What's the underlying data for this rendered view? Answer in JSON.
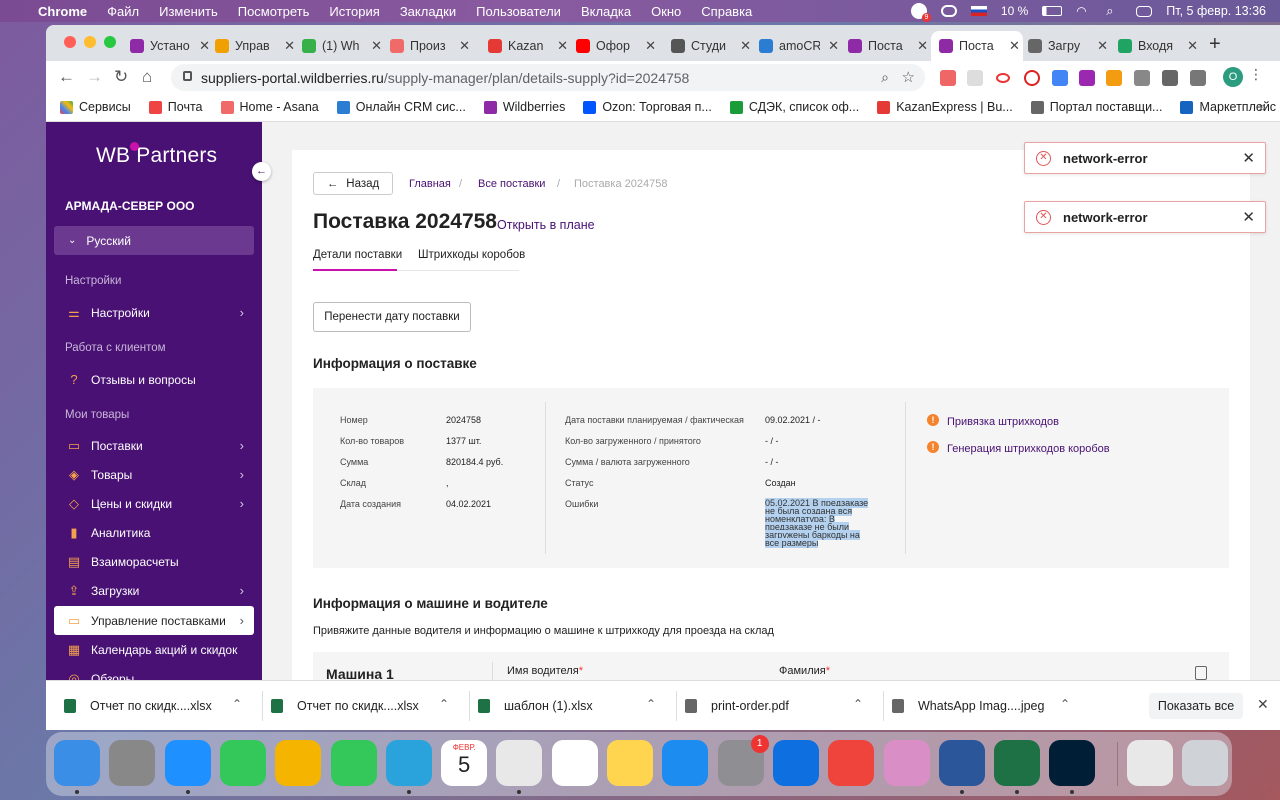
{
  "menubar": {
    "app": "Chrome",
    "menus": [
      "Файл",
      "Изменить",
      "Посмотреть",
      "История",
      "Закладки",
      "Пользователи",
      "Вкладка",
      "Окно",
      "Справка"
    ],
    "battery": "10 %",
    "datetime": "Пт, 5 февр.  13:36",
    "notification_count": "9"
  },
  "tabs": [
    {
      "title": "Устано",
      "icon": "wildberries-icon",
      "color": "#8e2aa5"
    },
    {
      "title": "Управ",
      "icon": "aliexpress-icon",
      "color": "#f0a000"
    },
    {
      "title": "(1) Wh",
      "icon": "whatsapp-icon",
      "color": "#36b14a"
    },
    {
      "title": "Произ",
      "icon": "asana-icon",
      "color": "#f06a6a"
    },
    {
      "title": "Kazan",
      "icon": "kazanexpress-icon",
      "color": "#e53935"
    },
    {
      "title": "Офор",
      "icon": "youtube-icon",
      "color": "#ff0000"
    },
    {
      "title": "Студи",
      "icon": "kazanexpress-icon",
      "color": "#555"
    },
    {
      "title": "amoCR",
      "icon": "amocrm-icon",
      "color": "#2b7cd3"
    },
    {
      "title": "Поста",
      "icon": "wildberries-icon",
      "color": "#8e2aa5"
    },
    {
      "title": "Поста",
      "icon": "wildberries-icon",
      "color": "#8e2aa5",
      "active": true
    },
    {
      "title": "Загру",
      "icon": "globe-icon",
      "color": "#666"
    },
    {
      "title": "Входя",
      "icon": "sheets-icon",
      "color": "#1fa463"
    }
  ],
  "address": {
    "host": "suppliers-portal.wildberries.ru",
    "path": "/supply-manager/plan/details-supply?id=2024758"
  },
  "profile_initial": "O",
  "bookmarks": [
    {
      "label": "Сервисы",
      "icon": "apps-icon",
      "color": "#e44"
    },
    {
      "label": "Почта",
      "icon": "gmail-icon",
      "color": "#e44"
    },
    {
      "label": "Home - Asana",
      "icon": "asana-icon",
      "color": "#f06a6a"
    },
    {
      "label": "Онлайн CRM сис...",
      "icon": "amocrm-icon",
      "color": "#2b7cd3"
    },
    {
      "label": "Wildberries",
      "icon": "wildberries-icon",
      "color": "#8e2aa5"
    },
    {
      "label": "Ozon: Торговая п...",
      "icon": "ozon-icon",
      "color": "#0055ff"
    },
    {
      "label": "СДЭК, список оф...",
      "icon": "cdek-icon",
      "color": "#1a9c3a"
    },
    {
      "label": "KazanExpress | Bu...",
      "icon": "kazanexpress-icon",
      "color": "#e53935"
    },
    {
      "label": "Портал поставщи...",
      "icon": "globe-icon",
      "color": "#666"
    },
    {
      "label": "Маркетплейс от...",
      "icon": "marketplace-icon",
      "color": "#1565c0"
    }
  ],
  "sidebar": {
    "logo": "WB Partners",
    "company": "АРМАДА-СЕВЕР ООО",
    "language": "Русский",
    "section_settings": "Настройки",
    "section_clients": "Работа с клиентом",
    "section_goods": "Мои товары",
    "items": [
      {
        "label": "Настройки",
        "chev": true
      },
      {
        "label": "Отзывы и вопросы",
        "chev": false
      },
      {
        "label": "Поставки",
        "chev": true
      },
      {
        "label": "Товары",
        "chev": true
      },
      {
        "label": "Цены и скидки",
        "chev": true
      },
      {
        "label": "Аналитика",
        "chev": false
      },
      {
        "label": "Взаиморасчеты",
        "chev": false
      },
      {
        "label": "Загрузки",
        "chev": true
      },
      {
        "label": "Управление поставками",
        "chev": true,
        "selected": true
      },
      {
        "label": "Календарь акций и скидок",
        "chev": false
      },
      {
        "label": "Обзоры",
        "chev": false
      }
    ]
  },
  "page": {
    "back": "Назад",
    "breadcrumb": [
      "Главная",
      "Все поставки",
      "Поставка 2024758"
    ],
    "breadcrumb_sep": "/",
    "title": "Поставка 2024758",
    "open_in_plan": "Открыть в плане",
    "tabs": [
      "Детали поставки",
      "Штрихкоды коробов"
    ],
    "move_date_button": "Перенести дату поставки",
    "info_title": "Информация о поставке",
    "info_left": [
      {
        "label": "Номер",
        "value": "2024758"
      },
      {
        "label": "Кол-во товаров",
        "value": "1377 шт."
      },
      {
        "label": "Сумма",
        "value": "820184.4 руб."
      },
      {
        "label": "Склад",
        "value": ","
      },
      {
        "label": "Дата создания",
        "value": "04.02.2021"
      }
    ],
    "info_mid": [
      {
        "label": "Дата поставки планируемая / фактическая",
        "value": "09.02.2021 / -"
      },
      {
        "label": "Кол-во загруженного / принятого",
        "value": "- / -"
      },
      {
        "label": "Сумма / валюта загруженного",
        "value": "- / -"
      },
      {
        "label": "Статус",
        "value": "Создан"
      },
      {
        "label": "Ошибки",
        "value": ""
      }
    ],
    "errors_text": "05.02.2021 В предзаказе не была создана вся номенклатура; В предзаказе не были загружены баркоды на все размеры",
    "links": [
      "Привязка штрихкодов",
      "Генерация штрихкодов коробов"
    ],
    "car_title": "Информация о машине и водителе",
    "car_subtitle": "Привяжите данные водителя и информацию о машине к штрихкоду для проезда на склад",
    "car_name": "Машина 1",
    "driver_name_label": "Имя водителя",
    "surname_label": "Фамилия",
    "required_mark": "*"
  },
  "toasts": [
    "network-error",
    "network-error"
  ],
  "downloads": [
    {
      "name": "Отчет по скидк....xlsx",
      "icon": "excel-file-icon",
      "color": "#1e7145"
    },
    {
      "name": "Отчет по скидк....xlsx",
      "icon": "excel-file-icon",
      "color": "#1e7145"
    },
    {
      "name": "шаблон (1).xlsx",
      "icon": "excel-file-icon",
      "color": "#1e7145"
    },
    {
      "name": "print-order.pdf",
      "icon": "pdf-file-icon",
      "color": "#666"
    },
    {
      "name": "WhatsApp Imag....jpeg",
      "icon": "image-file-icon",
      "color": "#666"
    }
  ],
  "show_all": "Показать все",
  "dock": [
    {
      "name": "finder-icon",
      "color": "#3a8ee6"
    },
    {
      "name": "launchpad-icon",
      "color": "#888"
    },
    {
      "name": "safari-icon",
      "color": "#1e90ff"
    },
    {
      "name": "messages-icon",
      "color": "#34c759"
    },
    {
      "name": "photos-icon",
      "color": "#f4b400"
    },
    {
      "name": "facetime-icon",
      "color": "#34c759"
    },
    {
      "name": "telegram-icon",
      "color": "#2aa3dc"
    },
    {
      "name": "calendar-icon",
      "color": "#ffffff"
    },
    {
      "name": "chrome-icon",
      "color": "#e8e8e8"
    },
    {
      "name": "reminders-icon",
      "color": "#ffffff"
    },
    {
      "name": "notes-icon",
      "color": "#ffd54f"
    },
    {
      "name": "appstore-icon",
      "color": "#1c8cf0"
    },
    {
      "name": "settings-icon",
      "color": "#8e8e93"
    },
    {
      "name": "teamviewer-icon",
      "color": "#0e6fe0"
    },
    {
      "name": "anydesk-icon",
      "color": "#ef443b"
    },
    {
      "name": "preview-icon",
      "color": "#d98ec6"
    },
    {
      "name": "word-icon",
      "color": "#2b579a"
    },
    {
      "name": "excel-icon",
      "color": "#1e7145"
    },
    {
      "name": "photoshop-icon",
      "color": "#001e36"
    },
    {
      "name": "downloads-stack-icon",
      "color": "#e8e8e8"
    },
    {
      "name": "trash-icon",
      "color": "#cfd3d8"
    }
  ],
  "calendar": {
    "month": "ФЕВР.",
    "day": "5"
  },
  "settings_badge": "1"
}
